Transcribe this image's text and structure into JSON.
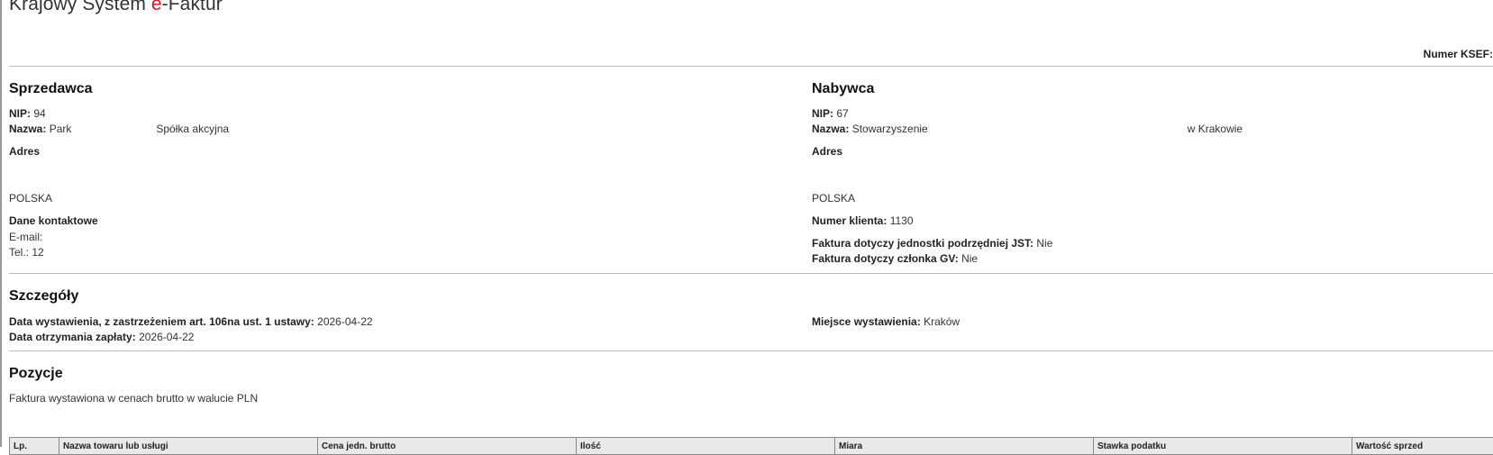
{
  "title": {
    "prefix": "Krajowy System ",
    "accent": "e",
    "suffix": "-Faktur"
  },
  "ksef_label": "Numer KSEF:",
  "seller": {
    "heading": "Sprzedawca",
    "nip_label": "NIP:",
    "nip_value": "94",
    "name_label": "Nazwa:",
    "name_value": "Park",
    "name_value_tail": "Spółka akcyjna",
    "address_heading": "Adres",
    "country": "POLSKA",
    "contact_heading": "Dane kontaktowe",
    "email_label": "E-mail:",
    "tel_label": "Tel.:",
    "tel_value": "12"
  },
  "buyer": {
    "heading": "Nabywca",
    "nip_label": "NIP:",
    "nip_value": "67",
    "name_label": "Nazwa:",
    "name_value": "Stowarzyszenie",
    "name_value_tail": "w Krakowie",
    "address_heading": "Adres",
    "country": "POLSKA",
    "client_no_label": "Numer klienta:",
    "client_no_value": "1130",
    "jst_label": "Faktura dotyczy jednostki podrzędniej JST:",
    "jst_value": "Nie",
    "gv_label": "Faktura dotyczy członka GV:",
    "gv_value": "Nie"
  },
  "details": {
    "heading": "Szczegóły",
    "issue_date_label": "Data wystawienia, z zastrzeżeniem art. 106na ust. 1 ustawy:",
    "issue_date_value": "2026-04-22",
    "payment_date_label": "Data otrzymania zapłaty:",
    "payment_date_value": "2026-04-22",
    "place_label": "Miejsce wystawienia:",
    "place_value": "Kraków"
  },
  "positions": {
    "heading": "Pozycje",
    "note": "Faktura wystawiona w cenach brutto w walucie PLN",
    "columns": [
      "Lp.",
      "Nazwa towaru lub usługi",
      "Cena jedn. brutto",
      "Ilość",
      "Miara",
      "Stawka podatku",
      "Wartość sprzed"
    ]
  }
}
